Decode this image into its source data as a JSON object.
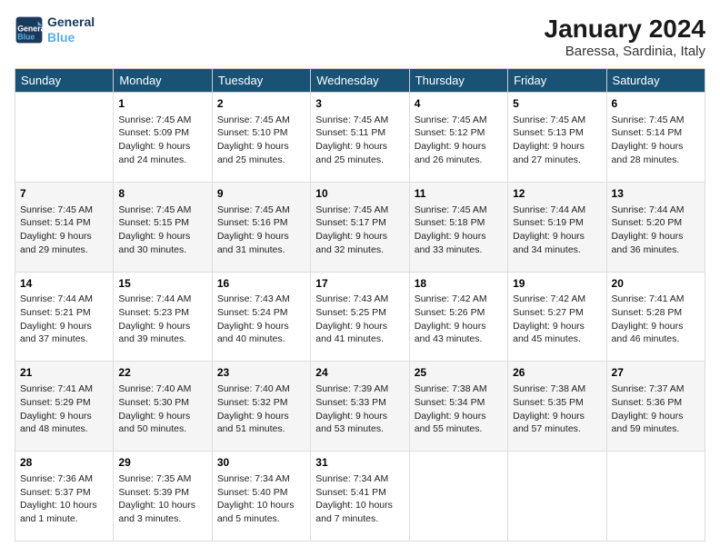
{
  "header": {
    "logo_line1": "General",
    "logo_line2": "Blue",
    "month": "January 2024",
    "location": "Baressa, Sardinia, Italy"
  },
  "weekdays": [
    "Sunday",
    "Monday",
    "Tuesday",
    "Wednesday",
    "Thursday",
    "Friday",
    "Saturday"
  ],
  "weeks": [
    [
      {
        "day": "",
        "sunrise": "",
        "sunset": "",
        "daylight": ""
      },
      {
        "day": "1",
        "sunrise": "Sunrise: 7:45 AM",
        "sunset": "Sunset: 5:09 PM",
        "daylight": "Daylight: 9 hours and 24 minutes."
      },
      {
        "day": "2",
        "sunrise": "Sunrise: 7:45 AM",
        "sunset": "Sunset: 5:10 PM",
        "daylight": "Daylight: 9 hours and 25 minutes."
      },
      {
        "day": "3",
        "sunrise": "Sunrise: 7:45 AM",
        "sunset": "Sunset: 5:11 PM",
        "daylight": "Daylight: 9 hours and 25 minutes."
      },
      {
        "day": "4",
        "sunrise": "Sunrise: 7:45 AM",
        "sunset": "Sunset: 5:12 PM",
        "daylight": "Daylight: 9 hours and 26 minutes."
      },
      {
        "day": "5",
        "sunrise": "Sunrise: 7:45 AM",
        "sunset": "Sunset: 5:13 PM",
        "daylight": "Daylight: 9 hours and 27 minutes."
      },
      {
        "day": "6",
        "sunrise": "Sunrise: 7:45 AM",
        "sunset": "Sunset: 5:14 PM",
        "daylight": "Daylight: 9 hours and 28 minutes."
      }
    ],
    [
      {
        "day": "7",
        "sunrise": "Sunrise: 7:45 AM",
        "sunset": "Sunset: 5:14 PM",
        "daylight": "Daylight: 9 hours and 29 minutes."
      },
      {
        "day": "8",
        "sunrise": "Sunrise: 7:45 AM",
        "sunset": "Sunset: 5:15 PM",
        "daylight": "Daylight: 9 hours and 30 minutes."
      },
      {
        "day": "9",
        "sunrise": "Sunrise: 7:45 AM",
        "sunset": "Sunset: 5:16 PM",
        "daylight": "Daylight: 9 hours and 31 minutes."
      },
      {
        "day": "10",
        "sunrise": "Sunrise: 7:45 AM",
        "sunset": "Sunset: 5:17 PM",
        "daylight": "Daylight: 9 hours and 32 minutes."
      },
      {
        "day": "11",
        "sunrise": "Sunrise: 7:45 AM",
        "sunset": "Sunset: 5:18 PM",
        "daylight": "Daylight: 9 hours and 33 minutes."
      },
      {
        "day": "12",
        "sunrise": "Sunrise: 7:44 AM",
        "sunset": "Sunset: 5:19 PM",
        "daylight": "Daylight: 9 hours and 34 minutes."
      },
      {
        "day": "13",
        "sunrise": "Sunrise: 7:44 AM",
        "sunset": "Sunset: 5:20 PM",
        "daylight": "Daylight: 9 hours and 36 minutes."
      }
    ],
    [
      {
        "day": "14",
        "sunrise": "Sunrise: 7:44 AM",
        "sunset": "Sunset: 5:21 PM",
        "daylight": "Daylight: 9 hours and 37 minutes."
      },
      {
        "day": "15",
        "sunrise": "Sunrise: 7:44 AM",
        "sunset": "Sunset: 5:23 PM",
        "daylight": "Daylight: 9 hours and 39 minutes."
      },
      {
        "day": "16",
        "sunrise": "Sunrise: 7:43 AM",
        "sunset": "Sunset: 5:24 PM",
        "daylight": "Daylight: 9 hours and 40 minutes."
      },
      {
        "day": "17",
        "sunrise": "Sunrise: 7:43 AM",
        "sunset": "Sunset: 5:25 PM",
        "daylight": "Daylight: 9 hours and 41 minutes."
      },
      {
        "day": "18",
        "sunrise": "Sunrise: 7:42 AM",
        "sunset": "Sunset: 5:26 PM",
        "daylight": "Daylight: 9 hours and 43 minutes."
      },
      {
        "day": "19",
        "sunrise": "Sunrise: 7:42 AM",
        "sunset": "Sunset: 5:27 PM",
        "daylight": "Daylight: 9 hours and 45 minutes."
      },
      {
        "day": "20",
        "sunrise": "Sunrise: 7:41 AM",
        "sunset": "Sunset: 5:28 PM",
        "daylight": "Daylight: 9 hours and 46 minutes."
      }
    ],
    [
      {
        "day": "21",
        "sunrise": "Sunrise: 7:41 AM",
        "sunset": "Sunset: 5:29 PM",
        "daylight": "Daylight: 9 hours and 48 minutes."
      },
      {
        "day": "22",
        "sunrise": "Sunrise: 7:40 AM",
        "sunset": "Sunset: 5:30 PM",
        "daylight": "Daylight: 9 hours and 50 minutes."
      },
      {
        "day": "23",
        "sunrise": "Sunrise: 7:40 AM",
        "sunset": "Sunset: 5:32 PM",
        "daylight": "Daylight: 9 hours and 51 minutes."
      },
      {
        "day": "24",
        "sunrise": "Sunrise: 7:39 AM",
        "sunset": "Sunset: 5:33 PM",
        "daylight": "Daylight: 9 hours and 53 minutes."
      },
      {
        "day": "25",
        "sunrise": "Sunrise: 7:38 AM",
        "sunset": "Sunset: 5:34 PM",
        "daylight": "Daylight: 9 hours and 55 minutes."
      },
      {
        "day": "26",
        "sunrise": "Sunrise: 7:38 AM",
        "sunset": "Sunset: 5:35 PM",
        "daylight": "Daylight: 9 hours and 57 minutes."
      },
      {
        "day": "27",
        "sunrise": "Sunrise: 7:37 AM",
        "sunset": "Sunset: 5:36 PM",
        "daylight": "Daylight: 9 hours and 59 minutes."
      }
    ],
    [
      {
        "day": "28",
        "sunrise": "Sunrise: 7:36 AM",
        "sunset": "Sunset: 5:37 PM",
        "daylight": "Daylight: 10 hours and 1 minute."
      },
      {
        "day": "29",
        "sunrise": "Sunrise: 7:35 AM",
        "sunset": "Sunset: 5:39 PM",
        "daylight": "Daylight: 10 hours and 3 minutes."
      },
      {
        "day": "30",
        "sunrise": "Sunrise: 7:34 AM",
        "sunset": "Sunset: 5:40 PM",
        "daylight": "Daylight: 10 hours and 5 minutes."
      },
      {
        "day": "31",
        "sunrise": "Sunrise: 7:34 AM",
        "sunset": "Sunset: 5:41 PM",
        "daylight": "Daylight: 10 hours and 7 minutes."
      },
      {
        "day": "",
        "sunrise": "",
        "sunset": "",
        "daylight": ""
      },
      {
        "day": "",
        "sunrise": "",
        "sunset": "",
        "daylight": ""
      },
      {
        "day": "",
        "sunrise": "",
        "sunset": "",
        "daylight": ""
      }
    ]
  ]
}
